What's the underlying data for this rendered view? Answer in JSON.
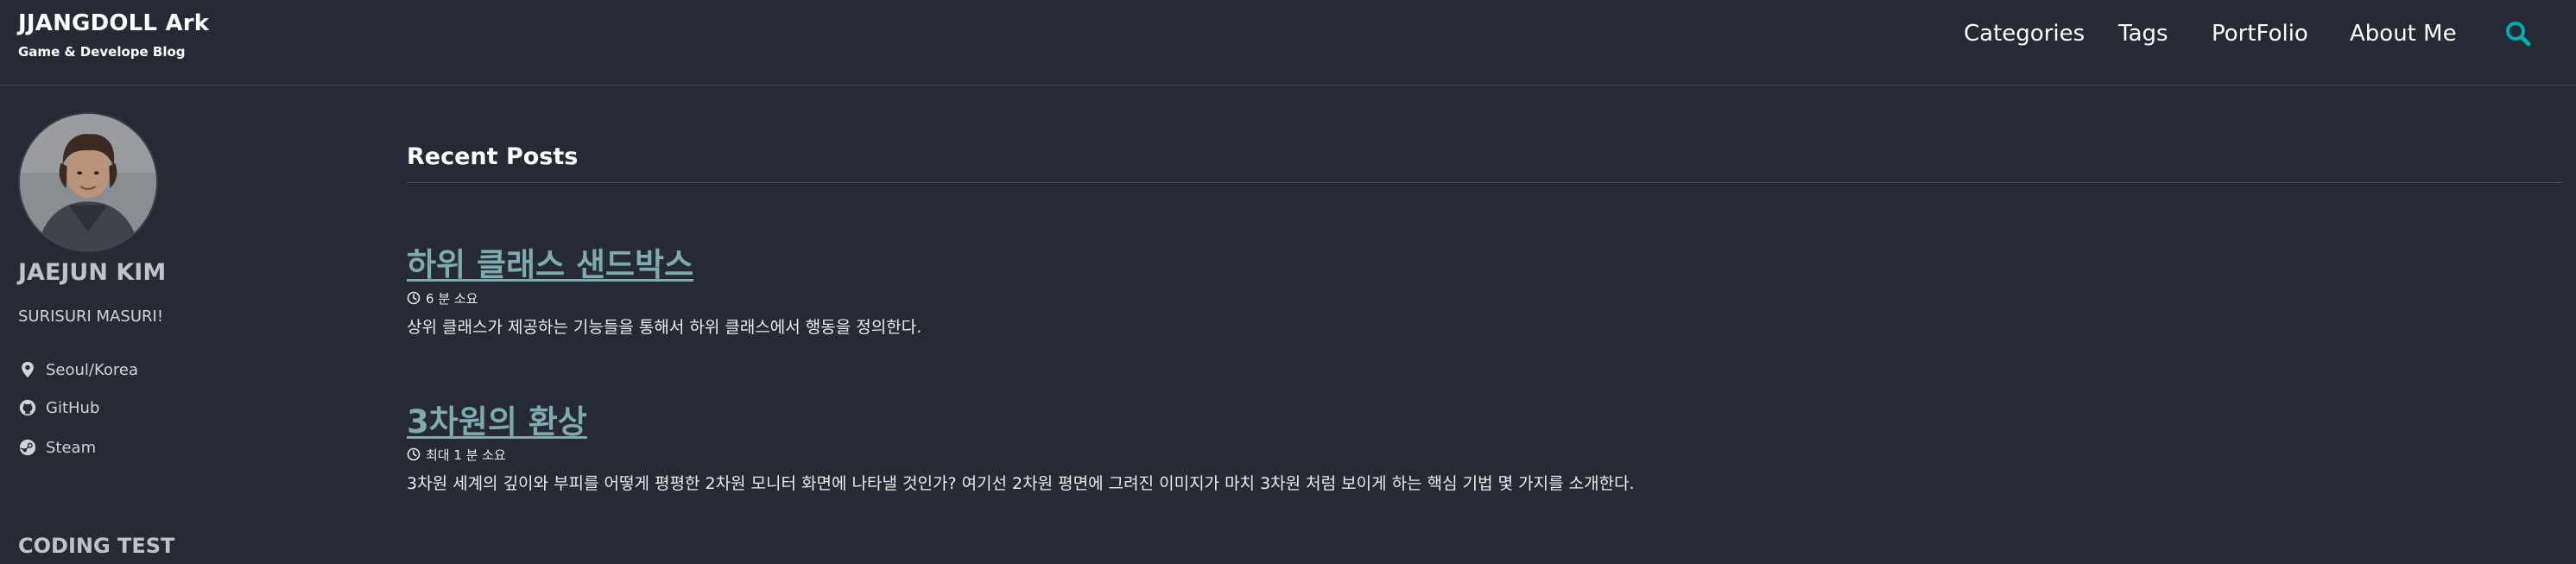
{
  "masthead": {
    "title": "JJANGDOLL Ark",
    "subtitle": "Game & Develope Blog",
    "nav": [
      {
        "label": "Categories"
      },
      {
        "label": "Tags"
      },
      {
        "label": "PortFolio"
      },
      {
        "label": "About Me"
      }
    ],
    "search_icon": "search-icon",
    "accent_color": "#00adb5"
  },
  "sidebar": {
    "author_name": "JAEJUN KIM",
    "bio": "SURISURI MASURI!",
    "links": [
      {
        "label": "Seoul/Korea",
        "icon": "map-marker-icon"
      },
      {
        "label": "GitHub",
        "icon": "github-icon"
      },
      {
        "label": "Steam",
        "icon": "steam-icon"
      }
    ],
    "heading": "CODING TEST"
  },
  "main": {
    "section_title": "Recent Posts",
    "posts": [
      {
        "title": "하위 클래스 샌드박스",
        "read_time": "6 분 소요",
        "excerpt": "상위 클래스가 제공하는 기능들을 통해서 하위 클래스에서 행동을 정의한다."
      },
      {
        "title": "3차원의 환상",
        "read_time": "최대 1 분 소요",
        "excerpt": "3차원 세계의 깊이와 부피를 어떻게 평평한 2차원 모니터 화면에 나타낼 것인가? 여기선 2차원 평면에 그려진 이미지가 마치 3차원 처럼 보이게 하는 핵심 기법 몇 가지를 소개한다."
      }
    ]
  },
  "colors": {
    "background": "#252a34",
    "link": "#7eaab0",
    "rule": "#4a4f59"
  }
}
